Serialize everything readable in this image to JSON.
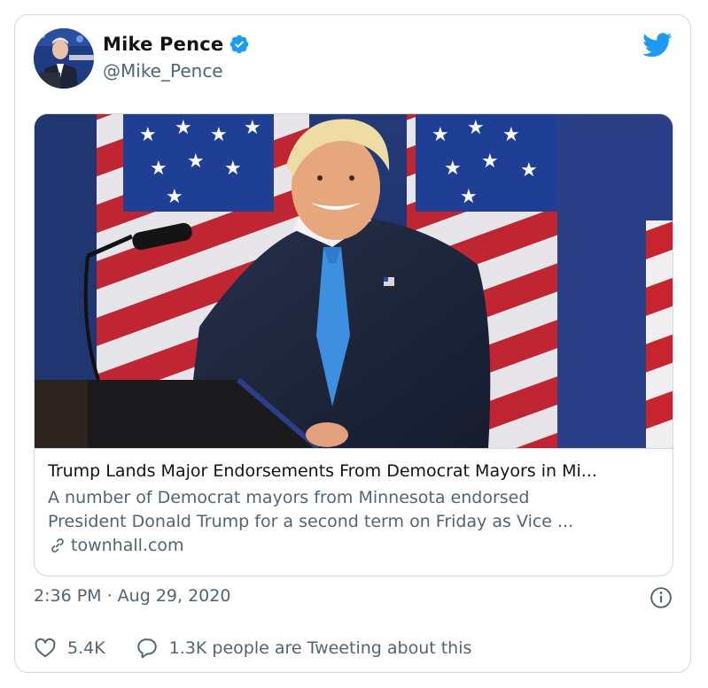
{
  "author": {
    "display_name": "Mike Pence",
    "handle": "@Mike_Pence",
    "verified": true,
    "avatar_icon": "profile-photo"
  },
  "card": {
    "image_description_icon": "photo",
    "title": "Trump Lands Major Endorsements From Democrat Mayors in Mi...",
    "description_line1": "A number of Democrat mayors from Minnesota endorsed",
    "description_line2": "President Donald Trump for a second term on Friday as Vice ...",
    "domain": "townhall.com"
  },
  "timestamp": "2:36 PM · Aug 29, 2020",
  "actions": {
    "likes": "5.4K",
    "tweeting": "1.3K people are Tweeting about this"
  },
  "colors": {
    "twitter_blue": "#1d9bf0",
    "verified_blue": "#1d9bf0",
    "secondary_text": "#536471",
    "border": "#cfd9de"
  }
}
